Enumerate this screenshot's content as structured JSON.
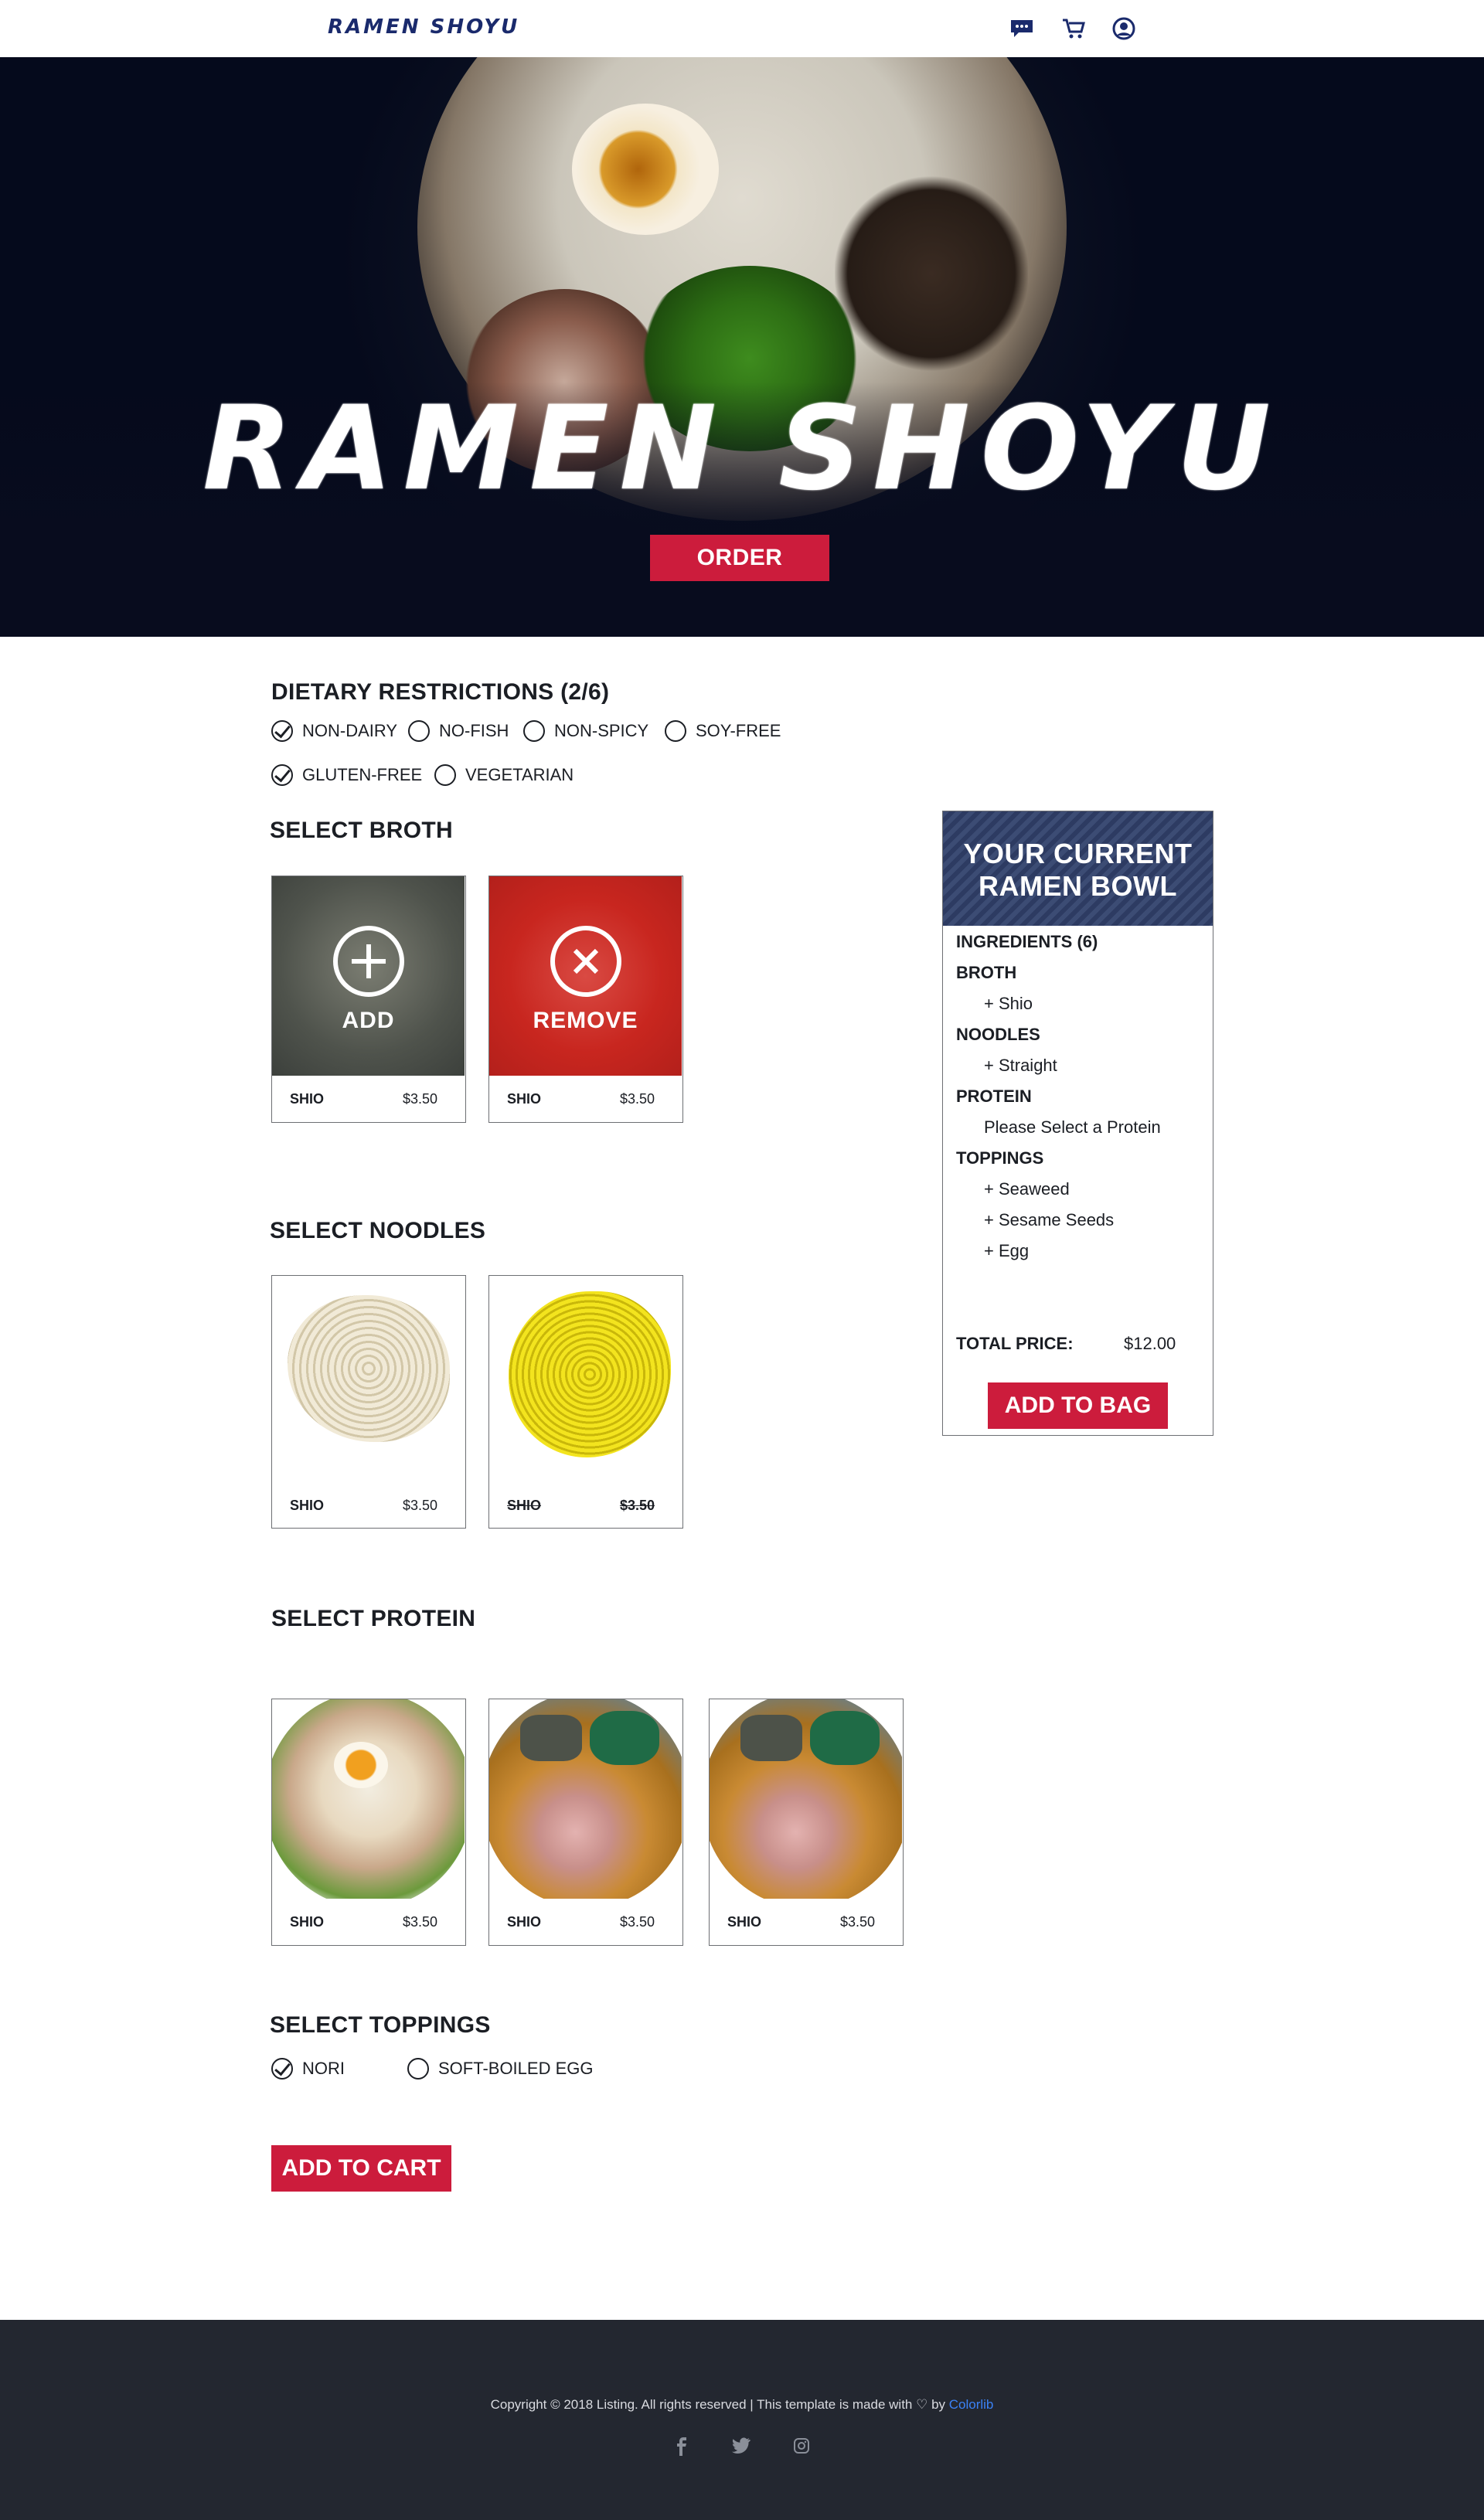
{
  "nav": {
    "logo": "RAMEN SHOYU",
    "icons": [
      "chat-icon",
      "cart-icon",
      "user-icon"
    ]
  },
  "hero": {
    "title": "RAMEN SHOYU",
    "order_label": "ORDER"
  },
  "dietary": {
    "title": "DIETARY RESTRICTIONS (2/6)",
    "options": [
      {
        "label": "NON-DAIRY",
        "checked": true
      },
      {
        "label": "NO-FISH",
        "checked": false
      },
      {
        "label": "NON-SPICY",
        "checked": false
      },
      {
        "label": "SOY-FREE",
        "checked": false
      },
      {
        "label": "GLUTEN-FREE",
        "checked": true
      },
      {
        "label": "VEGETARIAN",
        "checked": false
      }
    ]
  },
  "broth": {
    "title": "SELECT BROTH",
    "items": [
      {
        "name": "SHIO",
        "price": "$3.50",
        "overlay": "ADD"
      },
      {
        "name": "SHIO",
        "price": "$3.50",
        "overlay": "REMOVE"
      }
    ]
  },
  "noodles": {
    "title": "SELECT NOODLES",
    "items": [
      {
        "name": "SHIO",
        "price": "$3.50"
      },
      {
        "name": "SHIO",
        "price": "$3.50"
      }
    ]
  },
  "protein": {
    "title": "SELECT PROTEIN",
    "items": [
      {
        "name": "SHIO",
        "price": "$3.50"
      },
      {
        "name": "SHIO",
        "price": "$3.50"
      },
      {
        "name": "SHIO",
        "price": "$3.50"
      }
    ]
  },
  "toppings": {
    "title": "SELECT TOPPINGS",
    "options": [
      {
        "label": "NORI",
        "checked": true
      },
      {
        "label": "SOFT-BOILED EGG",
        "checked": false
      }
    ],
    "add_to_cart_label": "ADD TO CART"
  },
  "summary": {
    "title_line1": "YOUR CURRENT",
    "title_line2": "RAMEN BOWL",
    "ingredients_label": "INGREDIENTS (6)",
    "broth_label": "BROTH",
    "broth_item": "+ Shio",
    "noodles_label": "NOODLES",
    "noodles_item": "+ Straight",
    "protein_label": "PROTEIN",
    "protein_item": "Please Select a Protein",
    "toppings_label": "TOPPINGS",
    "toppings_items": [
      "+ Seaweed",
      "+ Sesame Seeds",
      "+ Egg"
    ],
    "total_label": "TOTAL PRICE:",
    "total_value": "$12.00",
    "add_to_bag_label": "ADD TO BAG"
  },
  "footer": {
    "copyright": "Copyright © 2018 Listing. All rights reserved | This template is made with ♡ by ",
    "credit": "Colorlib",
    "socials": [
      "facebook-icon",
      "twitter-icon",
      "instagram-icon"
    ]
  },
  "colors": {
    "accent": "#cc1c3c",
    "logo": "#1a2a6c",
    "footer_bg": "#232730",
    "link": "#3b82f6"
  }
}
